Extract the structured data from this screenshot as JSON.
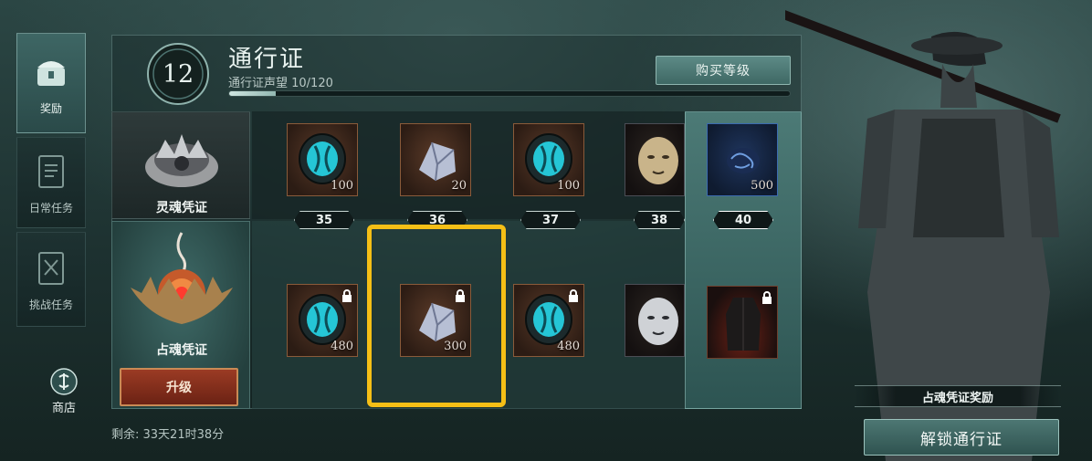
{
  "sidebar": {
    "tabs": [
      {
        "label": "奖励",
        "icon": "treasure-chest-icon",
        "active": true
      },
      {
        "label": "日常任务",
        "icon": "daily-book-icon",
        "active": false
      },
      {
        "label": "挑战任务",
        "icon": "challenge-book-icon",
        "active": false
      }
    ],
    "shop_label": "商店"
  },
  "header": {
    "level": "12",
    "title": "通行证",
    "prestige_text": "通行证声望 10/120",
    "progress_fraction": 0.083,
    "buy_level_label": "购买等级"
  },
  "tiers": {
    "free_name": "灵魂凭证",
    "paid_name": "占魂凭证",
    "upgrade_label": "升级"
  },
  "levels": [
    {
      "level": "35",
      "free": {
        "item": "soul-coin",
        "qty": "100"
      },
      "paid": {
        "item": "soul-coin",
        "qty": "480",
        "locked": true
      }
    },
    {
      "level": "36",
      "free": {
        "item": "crystal-shard",
        "qty": "20"
      },
      "paid": {
        "item": "crystal-shard",
        "qty": "300",
        "locked": true
      }
    },
    {
      "level": "37",
      "free": {
        "item": "soul-coin",
        "qty": "100"
      },
      "paid": {
        "item": "soul-coin",
        "qty": "480",
        "locked": true
      }
    },
    {
      "level": "38",
      "free": {
        "item": "golden-mask",
        "qty": ""
      },
      "paid": {
        "item": "silver-mask",
        "qty": "",
        "locked": true
      }
    },
    {
      "level": "40",
      "free": {
        "item": "blue-rune",
        "qty": "500"
      },
      "paid": {
        "item": "dark-coat",
        "qty": "",
        "locked": true
      },
      "highlighted": true
    }
  ],
  "footer": {
    "remaining": "剩余: 33天21时38分"
  },
  "right_panel": {
    "reward_caption": "占魂凭证奖励",
    "unlock_label": "解锁通行证"
  },
  "colors": {
    "accent_teal": "#5d8a86",
    "highlight_yellow": "#f5bf16",
    "upgrade_red": "#9b3b24"
  }
}
